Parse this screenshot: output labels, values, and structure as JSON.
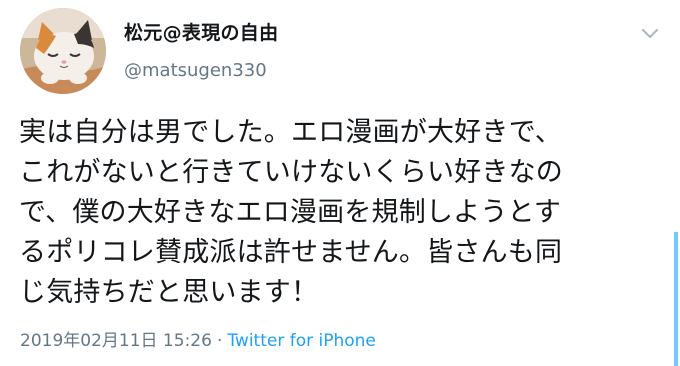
{
  "tweet": {
    "display_name": "松元@表現の自由",
    "handle": "@matsugen330",
    "text_lines": [
      "実は自分は男でした。エロ漫画が大好きで、",
      "これがないと行きていけないくらい好きなの",
      "で、僕の大好きなエロ漫画を規制しようとす",
      "るポリコレ賛成派は許せません。皆さんも同",
      "じ気持ちだと思います！"
    ],
    "timestamp": "2019年02月11日 15:26",
    "separator": "·",
    "source": "Twitter for iPhone"
  },
  "icons": {
    "avatar": "cat-avatar",
    "caret": "chevron-down-icon"
  },
  "colors": {
    "text": "#14171a",
    "secondary": "#657786",
    "link": "#1da1f2"
  }
}
